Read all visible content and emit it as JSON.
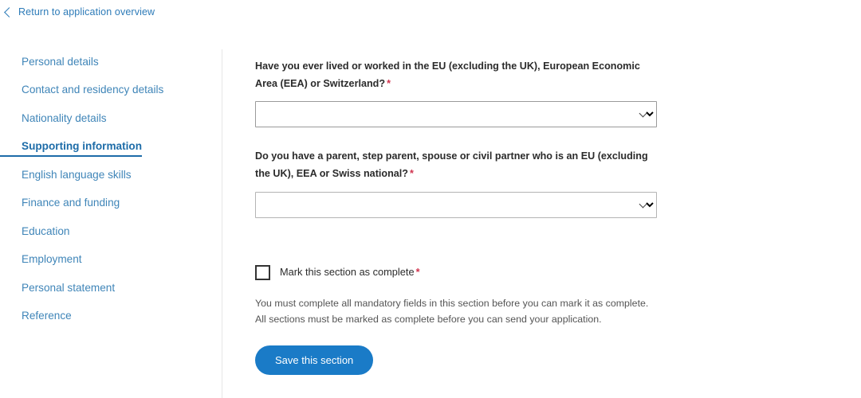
{
  "back_link": {
    "label": "Return to application overview",
    "icon": "chevron-left-icon"
  },
  "sidebar": {
    "items": [
      {
        "label": "Personal details",
        "active": false
      },
      {
        "label": "Contact and residency details",
        "active": false
      },
      {
        "label": "Nationality details",
        "active": false
      },
      {
        "label": "Supporting information",
        "active": true
      },
      {
        "label": "English language skills",
        "active": false
      },
      {
        "label": "Finance and funding",
        "active": false
      },
      {
        "label": "Education",
        "active": false
      },
      {
        "label": "Employment",
        "active": false
      },
      {
        "label": "Personal statement",
        "active": false
      },
      {
        "label": "Reference",
        "active": false
      }
    ]
  },
  "main": {
    "questions": [
      {
        "text": "Have you ever lived or worked in the EU (excluding the UK), European Economic Area (EEA) or Switzerland?",
        "required_marker": "*",
        "value": "",
        "icon": "chevron-down-icon"
      },
      {
        "text": "Do you have a parent, step parent, spouse or civil partner who is an EU (excluding the UK), EEA or Swiss national?",
        "required_marker": "*",
        "value": "",
        "icon": "chevron-down-icon"
      }
    ],
    "complete_checkbox": {
      "label": "Mark this section as complete",
      "required_marker": "*",
      "checked": false
    },
    "helper_text": "You must complete all mandatory fields in this section before you can mark it as complete. All sections must be marked as complete before you can send your application.",
    "save_button": "Save this section"
  },
  "colors": {
    "link_blue": "#3f85b8",
    "active_blue": "#1d6ca8",
    "button_blue": "#1a7bc7",
    "required_red": "#d0334e",
    "text": "#2b2b2b",
    "helper_text": "#555555",
    "divider": "#e6e6e6"
  }
}
